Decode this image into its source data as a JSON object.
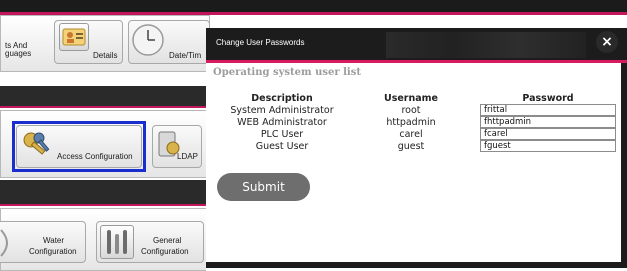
{
  "background": {
    "tiles": {
      "row1": {
        "partial_text_line1": "ts And",
        "partial_text_line2": "guages",
        "details": "Details",
        "date_time": "Date/Tim"
      },
      "row2": {
        "access_configuration": "Access Configuration",
        "ldap": "LDAP"
      },
      "row3": {
        "water_line1": "Water",
        "water_line2": "Configuration",
        "general_line1": "General",
        "general_line2": "Configuration"
      }
    }
  },
  "dialog": {
    "title": "Change User Passwords",
    "close_glyph": "×",
    "subtitle": "Operating system user list",
    "columns": [
      "Description",
      "Username",
      "Password"
    ],
    "rows": [
      {
        "description": "System Administrator",
        "username": "root",
        "password": "frittal"
      },
      {
        "description": "WEB Administrator",
        "username": "httpadmin",
        "password": "fhttpadmin"
      },
      {
        "description": "PLC User",
        "username": "carel",
        "password": "fcarel"
      },
      {
        "description": "Guest User",
        "username": "guest",
        "password": "fguest"
      }
    ],
    "submit_label": "Submit"
  },
  "colors": {
    "accent": "#c2185b",
    "selection_border": "#1a2ecf",
    "dialog_header": "#1c1c1c",
    "submit_button": "#6e6e6e"
  }
}
